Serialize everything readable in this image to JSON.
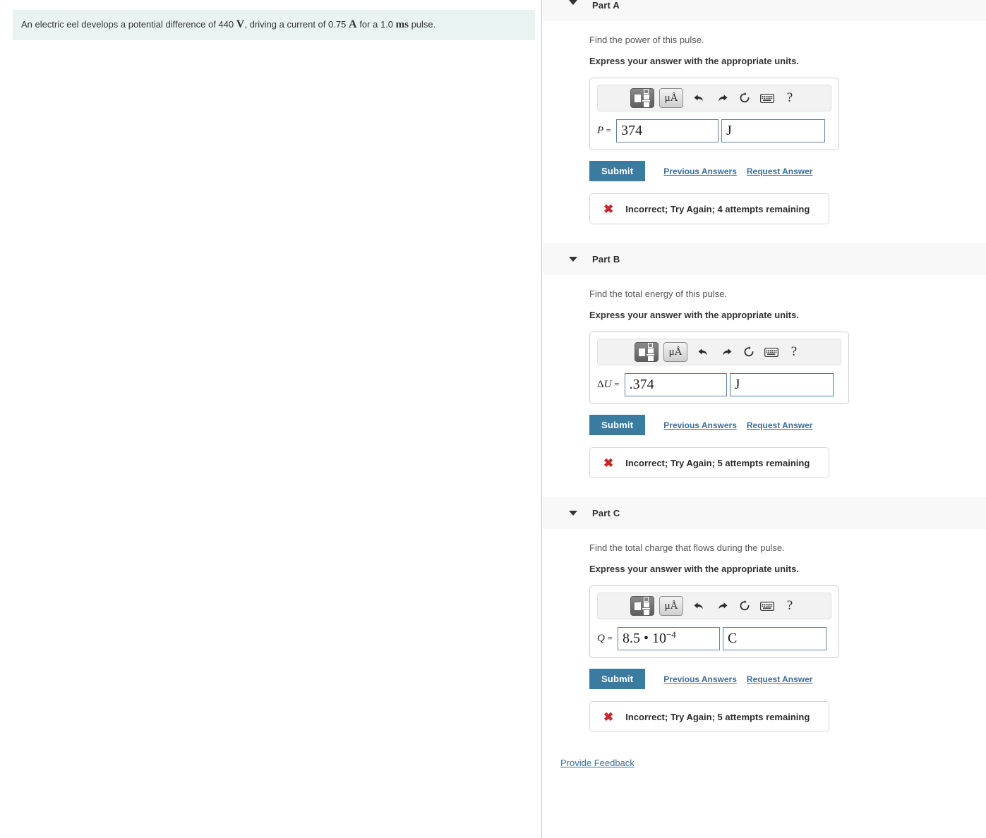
{
  "question": {
    "text_before_v": "An electric eel develops a potential difference of 440 ",
    "unit_v": "V",
    "text_mid": ", driving a current of 0.75 ",
    "unit_a": "A",
    "text_after": " for a 1.0 ",
    "unit_ms": "ms",
    "text_end": " pulse."
  },
  "toolbar": {
    "template_label": "template-button",
    "units_label": "μÅ",
    "undo_label": "⮠",
    "redo_label": "⮡",
    "reset_label": "⟳",
    "keyboard_label": "⌨",
    "help_label": "?"
  },
  "actions": {
    "submit_label": "Submit",
    "previous_answers_label": "Previous Answers",
    "request_answer_label": "Request Answer"
  },
  "footer": {
    "provide_feedback_label": "Provide Feedback"
  },
  "parts": [
    {
      "title": "Part A",
      "prompt": "Find the power of this pulse.",
      "instruction": "Express your answer with the appropriate units.",
      "variable": "P",
      "variable_prefix": "",
      "equals": "=",
      "value": "374",
      "value_exponent": "",
      "unit": "J",
      "unit_focused": false,
      "feedback": "Incorrect; Try Again; 4 attempts remaining",
      "feedback_icon": "✖"
    },
    {
      "title": "Part B",
      "prompt": "Find the total energy of this pulse.",
      "instruction": "Express your answer with the appropriate units.",
      "variable": "U",
      "variable_prefix": "Δ",
      "equals": "=",
      "value": ".374",
      "value_exponent": "",
      "unit": "J",
      "unit_focused": true,
      "feedback": "Incorrect; Try Again; 5 attempts remaining",
      "feedback_icon": "✖"
    },
    {
      "title": "Part C",
      "prompt": "Find the total charge that flows during the pulse.",
      "instruction": "Express your answer with the appropriate units.",
      "variable": "Q",
      "variable_prefix": "",
      "equals": "=",
      "value": "8.5 • 10",
      "value_exponent": "−4",
      "unit": "C",
      "unit_focused": false,
      "feedback": "Incorrect; Try Again; 5 attempts remaining",
      "feedback_icon": "✖"
    }
  ],
  "colors": {
    "question_bg": "#e9f4f2",
    "submit_bg": "#3c7ba0",
    "link": "#3c6f99",
    "error": "#c9252c",
    "part_header_bg": "#f8f8f8",
    "field_border": "#5b86a5"
  }
}
